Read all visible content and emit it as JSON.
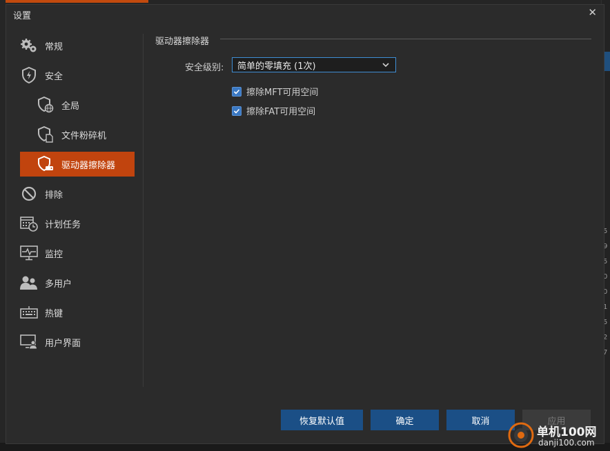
{
  "dialog": {
    "title": "设置",
    "close_glyph": "✕"
  },
  "sidebar": {
    "items": [
      {
        "label": "常规",
        "icon": "gears-icon"
      },
      {
        "label": "安全",
        "icon": "shield-lightning-icon"
      },
      {
        "label": "全局",
        "icon": "shield-globe-icon"
      },
      {
        "label": "文件粉碎机",
        "icon": "shield-file-icon"
      },
      {
        "label": "驱动器擦除器",
        "icon": "shield-drive-icon"
      },
      {
        "label": "排除",
        "icon": "prohibited-icon"
      },
      {
        "label": "计划任务",
        "icon": "calendar-clock-icon"
      },
      {
        "label": "监控",
        "icon": "monitor-pulse-icon"
      },
      {
        "label": "多用户",
        "icon": "users-icon"
      },
      {
        "label": "热键",
        "icon": "keyboard-icon"
      },
      {
        "label": "用户界面",
        "icon": "monitor-user-icon"
      }
    ],
    "active_index": 4
  },
  "content": {
    "section_title": "驱动器擦除器",
    "security_level_label": "安全级别:",
    "security_level_value": "简单的零填充 (1次)",
    "checkboxes": [
      {
        "label": "擦除MFT可用空间",
        "checked": true
      },
      {
        "label": "擦除FAT可用空间",
        "checked": true
      }
    ]
  },
  "buttons": {
    "restore_defaults": "恢复默认值",
    "ok": "确定",
    "cancel": "取消",
    "apply": "应用"
  },
  "background": {
    "right_numbers": [
      "5",
      "9",
      "5",
      "0",
      "0",
      "1",
      "5",
      "2",
      "7"
    ]
  },
  "watermark": {
    "title": "单机100网",
    "url": "danji100.com"
  },
  "colors": {
    "accent_active": "#c1440e",
    "button_primary": "#1b4f86",
    "dialog_bg": "#2b2b2b",
    "checkbox": "#3a78c3"
  }
}
